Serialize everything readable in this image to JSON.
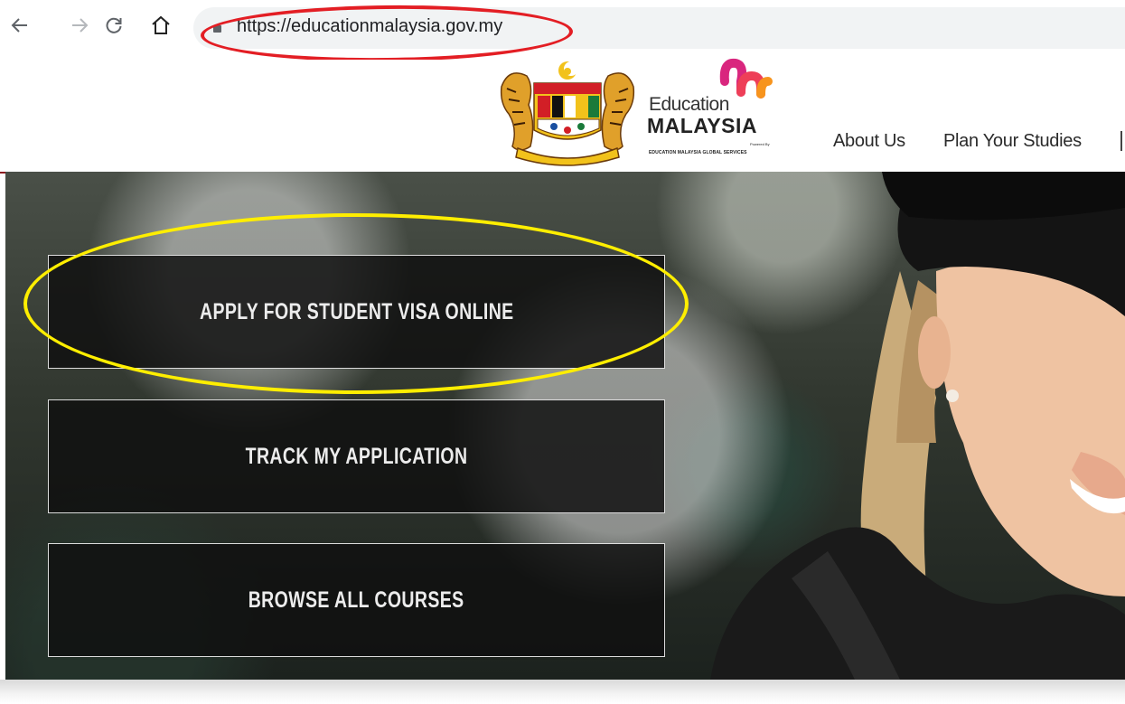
{
  "browser": {
    "url": "https://educationmalaysia.gov.my",
    "icons": [
      "back-arrow-icon",
      "forward-arrow-icon",
      "reload-icon",
      "home-icon",
      "lock-icon"
    ]
  },
  "site": {
    "brand": {
      "line1": "Education",
      "line2": "MALAYSIA",
      "tagline": "EDUCATION MALAYSIA GLOBAL SERVICES",
      "powered_by": "Powered By"
    },
    "menu": [
      "About Us",
      "Plan Your Studies"
    ]
  },
  "hero": {
    "buttons": [
      "APPLY FOR STUDENT VISA ONLINE",
      "TRACK MY APPLICATION",
      "BROWSE ALL COURSES"
    ]
  },
  "annotations": {
    "url_highlight_color": "#e31e24",
    "button_highlight_color": "#ffee00"
  }
}
